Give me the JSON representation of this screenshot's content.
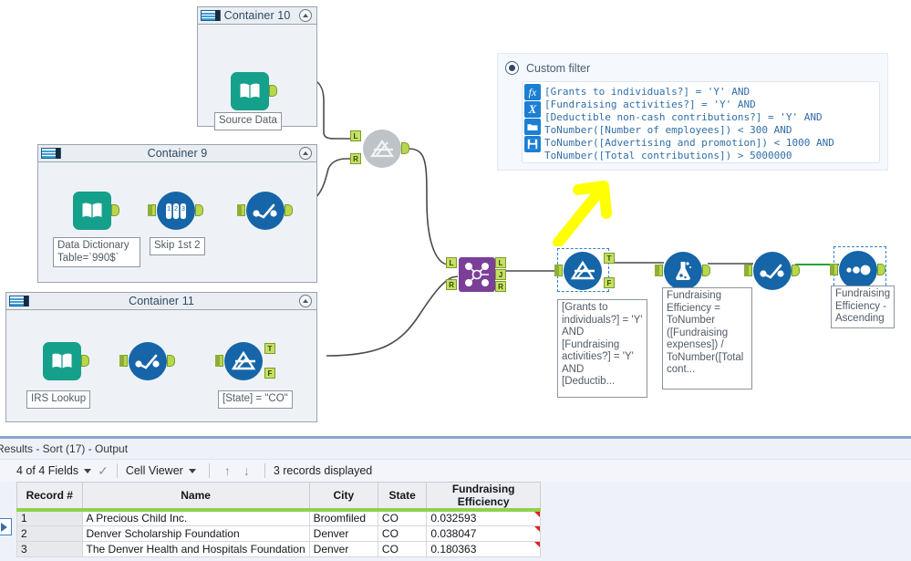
{
  "app": "Alteryx Designer workflow canvas",
  "canvas": {
    "containers": [
      {
        "title": "Container 10",
        "icon": "container-icon",
        "collapse_icon": "collapse-chevron-icon"
      },
      {
        "title": "Container 9",
        "icon": "container-icon",
        "collapse_icon": "collapse-chevron-icon"
      },
      {
        "title": "Container 11",
        "icon": "container-icon",
        "collapse_icon": "collapse-chevron-icon"
      }
    ],
    "nodes": [
      {
        "id": "source-data",
        "icon": "input-data-book-icon",
        "label": "Source Data"
      },
      {
        "id": "data-dictionary",
        "icon": "input-data-book-icon",
        "label": "Data Dictionary\nTable=`990$`"
      },
      {
        "id": "skip-first-2",
        "icon": "sample-tool-icon",
        "label": "Skip 1st 2"
      },
      {
        "id": "select-c9",
        "icon": "select-tool-icon",
        "label": ""
      },
      {
        "id": "irs-lookup",
        "icon": "input-data-book-icon",
        "label": "IRS Lookup"
      },
      {
        "id": "select-c11",
        "icon": "select-tool-icon",
        "label": ""
      },
      {
        "id": "filter-state",
        "icon": "filter-tool-icon",
        "label": "[State] = \"CO\""
      },
      {
        "id": "join-disabled",
        "icon": "join-tool-disabled-icon",
        "label": ""
      },
      {
        "id": "join-purple",
        "icon": "join-tool-icon",
        "label": ""
      },
      {
        "id": "filter-custom",
        "icon": "filter-tool-icon",
        "label": "[Grants to individuals?] = 'Y'\nAND\n[Fundraising activities?] = 'Y'\nAND\n[Deductib..."
      },
      {
        "id": "formula",
        "icon": "formula-tool-icon",
        "label": "Fundraising Efficiency = ToNumber ([Fundraising expenses]) / ToNumber([Total cont..."
      },
      {
        "id": "select-final",
        "icon": "select-tool-icon",
        "label": ""
      },
      {
        "id": "sort",
        "icon": "sort-tool-icon",
        "label": "Fundraising Efficiency - Ascending"
      }
    ],
    "port_labels": {
      "true": "T",
      "false": "F",
      "left": "L",
      "right": "R",
      "join": "J"
    },
    "annotation_arrow": "yellow-arrow-pointing-up"
  },
  "filter_panel": {
    "radio_label": "Custom filter",
    "radio_selected": true,
    "icons": [
      "fx-function-icon",
      "x-variable-icon",
      "open-folder-icon",
      "save-disk-icon"
    ],
    "expression": "[Grants to individuals?] = 'Y' AND\n[Fundraising activities?] = 'Y' AND\n[Deductible non-cash contributions?] = 'Y' AND\nToNumber([Number of employees]) < 300 AND\nToNumber([Advertising and promotion]) < 1000 AND\nToNumber([Total contributions]) > 5000000"
  },
  "results": {
    "title": "Results - Sort (17) - Output",
    "toolbar": {
      "fields": "4 of 4 Fields",
      "fields_caret": "chevron-down-icon",
      "check": "check-icon",
      "viewer": "Cell Viewer",
      "viewer_caret": "chevron-down-icon",
      "up_arrow": "arrow-up-icon",
      "down_arrow": "arrow-down-icon",
      "record_count": "3 records displayed"
    },
    "table": {
      "columns": [
        "Record #",
        "Name",
        "City",
        "State",
        "Fundraising Efficiency"
      ],
      "rows": [
        [
          "1",
          "A Precious Child Inc.",
          "Broomfiled",
          "CO",
          "0.032593"
        ],
        [
          "2",
          "Denver Scholarship Foundation",
          "Denver",
          "CO",
          "0.038047"
        ],
        [
          "3",
          "The Denver Health and Hospitals Foundation",
          "Denver",
          "CO",
          "0.180363"
        ]
      ]
    },
    "run_button": "run-play-icon"
  },
  "colors": {
    "node_blue": "#1565a8",
    "node_teal": "#15a08c",
    "node_purple": "#7b3f98",
    "pip_green": "#b6d84a",
    "arrow_yellow": "#ffff00",
    "header_green": "#8fd24a",
    "expr_blue": "#2f6ea8"
  }
}
